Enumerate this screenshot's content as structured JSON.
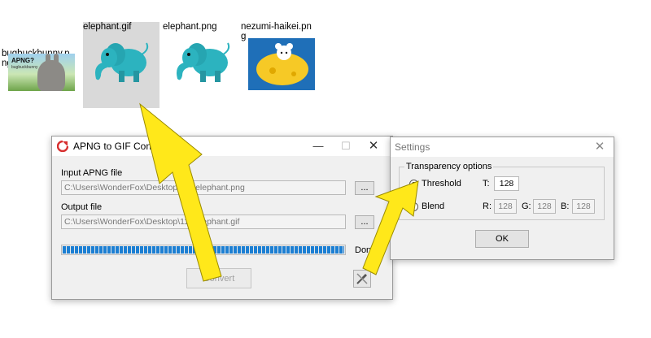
{
  "desktop": {
    "files": [
      {
        "name_line1": "bugbuckbunny.p",
        "name_line2": "ng",
        "thumb_text": "APNG?",
        "thumb_subtext": "bugbuckbunny"
      },
      {
        "name_line1": "elephant.gif",
        "name_line2": "",
        "selected": true
      },
      {
        "name_line1": "elephant.png",
        "name_line2": ""
      },
      {
        "name_line1": "nezumi-haikei.pn",
        "name_line2": "g"
      }
    ]
  },
  "converter": {
    "title": "APNG to GIF Conve",
    "input_label": "Input APNG file",
    "input_value": "C:\\Users\\WonderFox\\Desktop\\111\\elephant.png",
    "input_browse": "...",
    "output_label": "Output file",
    "output_value": "C:\\Users\\WonderFox\\Desktop\\111\\elephant.gif",
    "output_browse": "...",
    "progress": 1.0,
    "status": "Done",
    "convert_button": "Convert"
  },
  "settings": {
    "title": "Settings",
    "group_label": "Transparency options",
    "threshold_label": "Threshold",
    "threshold_selected": true,
    "t_label": "T:",
    "t_value": "128",
    "blend_label": "Blend",
    "r_label": "R:",
    "r_value": "128",
    "g_label": "G:",
    "g_value": "128",
    "b_label": "B:",
    "b_value": "128",
    "ok_button": "OK"
  },
  "colors": {
    "arrow": "#ffe81a",
    "progress": "#1c7fd3",
    "icon_red": "#d72f2f"
  }
}
